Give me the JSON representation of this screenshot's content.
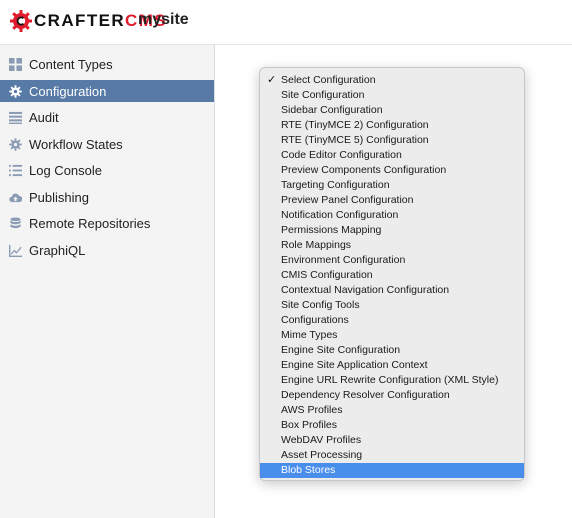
{
  "header": {
    "logo_prefix": "CRAFTER",
    "logo_suffix": "CMS",
    "site_name": "mysite"
  },
  "sidebar": {
    "items": [
      {
        "label": "Content Types",
        "icon": "grid-icon"
      },
      {
        "label": "Configuration",
        "icon": "gear-icon",
        "active": true
      },
      {
        "label": "Audit",
        "icon": "list-icon"
      },
      {
        "label": "Workflow States",
        "icon": "gear-icon"
      },
      {
        "label": "Log Console",
        "icon": "lines-icon"
      },
      {
        "label": "Publishing",
        "icon": "cloud-upload-icon"
      },
      {
        "label": "Remote Repositories",
        "icon": "database-icon"
      },
      {
        "label": "GraphiQL",
        "icon": "line-chart-icon"
      }
    ]
  },
  "config_select": {
    "checked_option": "Select Configuration",
    "highlighted_option": "Blob Stores",
    "options": [
      "Select Configuration",
      "Site Configuration",
      "Sidebar Configuration",
      "RTE (TinyMCE 2) Configuration",
      "RTE (TinyMCE 5) Configuration",
      "Code Editor Configuration",
      "Preview Components Configuration",
      "Targeting Configuration",
      "Preview Panel Configuration",
      "Notification Configuration",
      "Permissions Mapping",
      "Role Mappings",
      "Environment Configuration",
      "CMIS Configuration",
      "Contextual Navigation Configuration",
      "Site Config Tools",
      "Configurations",
      "Mime Types",
      "Engine Site Configuration",
      "Engine Site Application Context",
      "Engine URL Rewrite Configuration (XML Style)",
      "Dependency Resolver Configuration",
      "AWS Profiles",
      "Box Profiles",
      "WebDAV Profiles",
      "Asset Processing",
      "Blob Stores"
    ]
  },
  "colors": {
    "brand_red": "#e01c2f",
    "active_nav": "#587aa6",
    "menu_highlight": "#4a8eeb",
    "sidebar_bg": "#f4f4f4"
  }
}
